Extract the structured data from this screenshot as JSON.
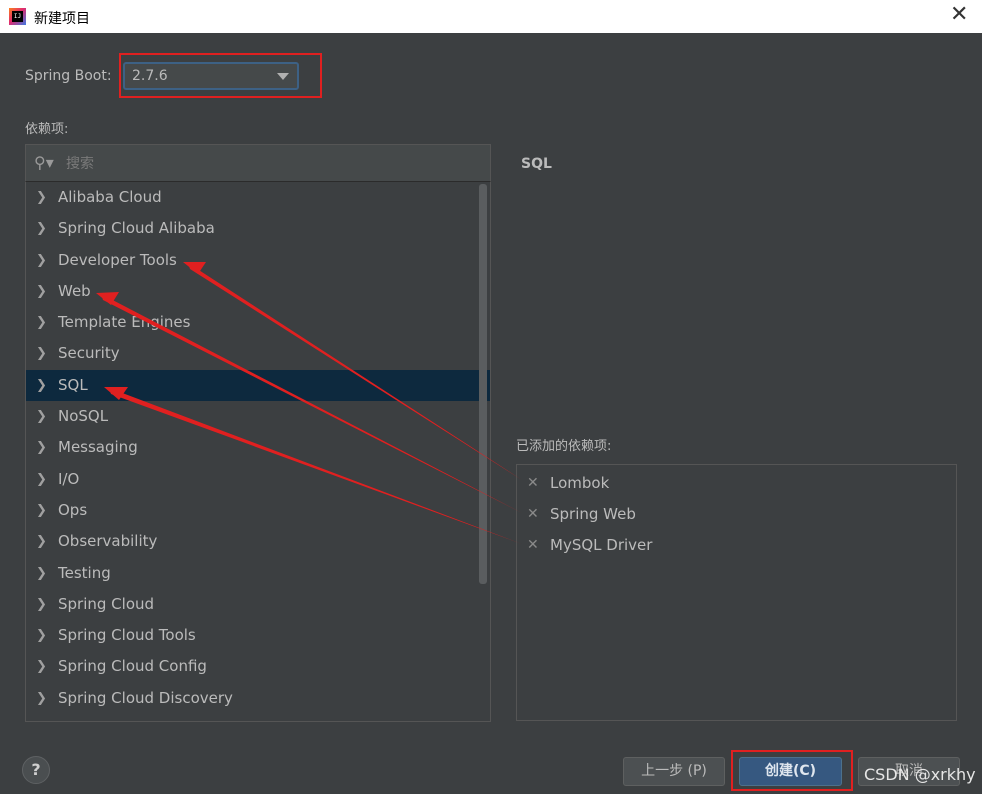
{
  "window": {
    "title": "新建项目",
    "close_glyph": "✕"
  },
  "spring_boot": {
    "label": "Spring Boot:",
    "version": "2.7.6"
  },
  "dependencies": {
    "label": "依赖项:",
    "search_placeholder": "搜索",
    "categories": [
      "Alibaba Cloud",
      "Spring Cloud Alibaba",
      "Developer Tools",
      "Web",
      "Template Engines",
      "Security",
      "SQL",
      "NoSQL",
      "Messaging",
      "I/O",
      "Ops",
      "Observability",
      "Testing",
      "Spring Cloud",
      "Spring Cloud Tools",
      "Spring Cloud Config",
      "Spring Cloud Discovery"
    ],
    "selected": "SQL"
  },
  "detail": {
    "title": "SQL"
  },
  "added": {
    "label": "已添加的依赖项:",
    "items": [
      "Lombok",
      "Spring Web",
      "MySQL Driver"
    ]
  },
  "footer": {
    "help": "?",
    "prev": "上一步 (P)",
    "create": "创建(C)",
    "cancel": "取消"
  },
  "watermark": "CSDN @xrkhy",
  "colors": {
    "annotation": "#e02020",
    "accent": "#365880",
    "selection": "#0d293e"
  }
}
